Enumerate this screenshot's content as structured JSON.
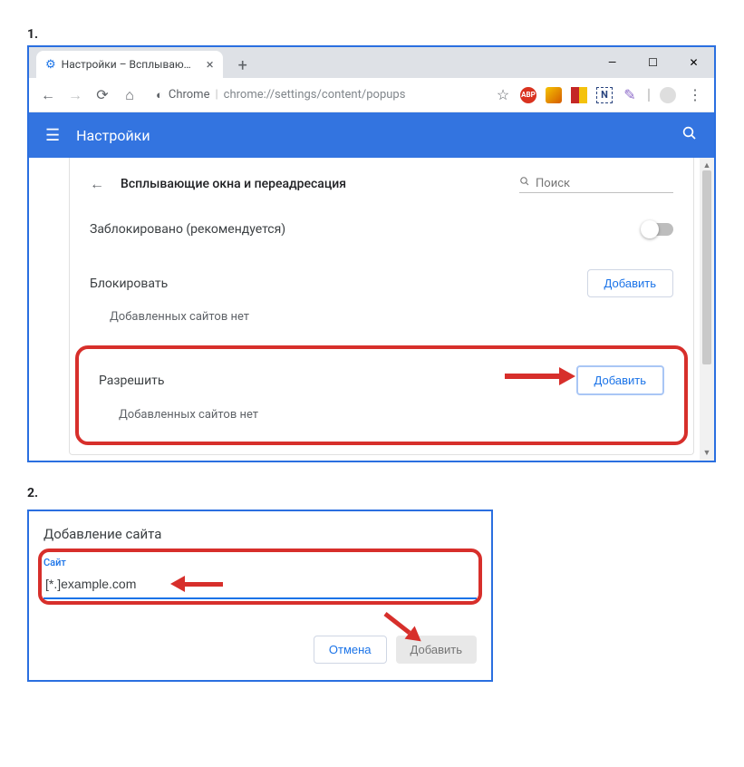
{
  "steps": {
    "one": "1.",
    "two": "2."
  },
  "browser": {
    "tab_title": "Настройки – Всплывающие окн",
    "url_scheme": "Chrome",
    "url_path": "chrome://settings/content/popups"
  },
  "header": {
    "title": "Настройки"
  },
  "page": {
    "back_icon": "←",
    "heading": "Всплывающие окна и переадресация",
    "search_placeholder": "Поиск",
    "blocked_label": "Заблокировано (рекомендуется)",
    "block_section_label": "Блокировать",
    "allow_section_label": "Разрешить",
    "add_button": "Добавить",
    "no_sites": "Добавленных сайтов нет"
  },
  "dialog": {
    "title": "Добавление сайта",
    "field_label": "Сайт",
    "input_value": "[*.]example.com",
    "cancel": "Отмена",
    "add": "Добавить"
  }
}
